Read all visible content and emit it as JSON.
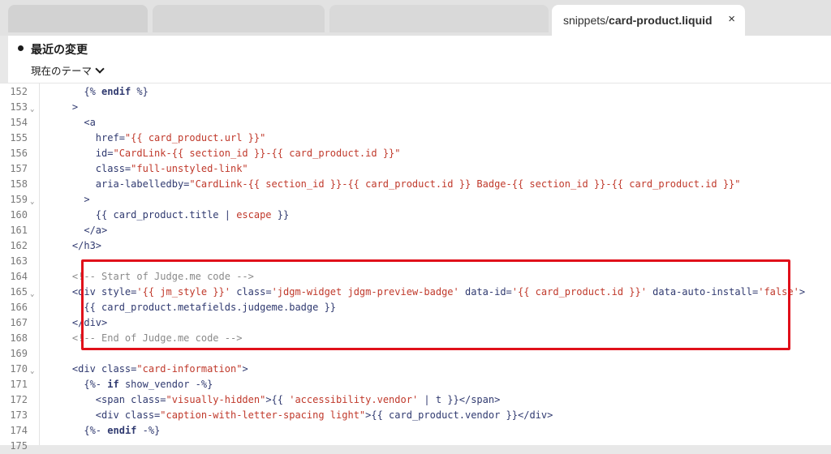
{
  "tabs": {
    "active": {
      "prefix": "snippets/",
      "name": "card-product.liquid"
    },
    "close_glyph": "×"
  },
  "header": {
    "title": "最近の変更",
    "theme_selector": "現在のテーマ"
  },
  "colors": {
    "highlight_border": "#e0101a",
    "string": "#c0392b",
    "comment": "#8a8a8a",
    "code": "#303a70"
  },
  "code": {
    "first_line_visible": 152,
    "lines": [
      {
        "n": "152",
        "fold": false,
        "indent": "      ",
        "segs": [
          [
            "{% ",
            "k"
          ],
          [
            "endif",
            "kw"
          ],
          [
            " %}",
            "k"
          ]
        ]
      },
      {
        "n": "153",
        "fold": true,
        "indent": "    ",
        "segs": [
          [
            ">",
            "k"
          ]
        ]
      },
      {
        "n": "154",
        "fold": false,
        "indent": "      ",
        "segs": [
          [
            "<a",
            "k"
          ]
        ]
      },
      {
        "n": "155",
        "fold": false,
        "indent": "        ",
        "segs": [
          [
            "href=",
            "k"
          ],
          [
            "\"{{ card_product.url }}\"",
            "s"
          ]
        ]
      },
      {
        "n": "156",
        "fold": false,
        "indent": "        ",
        "segs": [
          [
            "id=",
            "k"
          ],
          [
            "\"CardLink-{{ section_id }}-{{ card_product.id }}\"",
            "s"
          ]
        ]
      },
      {
        "n": "157",
        "fold": false,
        "indent": "        ",
        "segs": [
          [
            "class=",
            "k"
          ],
          [
            "\"full-unstyled-link\"",
            "s"
          ]
        ]
      },
      {
        "n": "158",
        "fold": false,
        "indent": "        ",
        "segs": [
          [
            "aria-labelledby=",
            "k"
          ],
          [
            "\"CardLink-{{ section_id }}-{{ card_product.id }} Badge-{{ section_id }}-{{ card_product.id }}\"",
            "s"
          ]
        ]
      },
      {
        "n": "159",
        "fold": true,
        "indent": "      ",
        "segs": [
          [
            ">",
            "k"
          ]
        ]
      },
      {
        "n": "160",
        "fold": false,
        "indent": "        ",
        "segs": [
          [
            "{{ card_product.title | ",
            "k"
          ],
          [
            "escape",
            "s"
          ],
          [
            " }}",
            "k"
          ]
        ]
      },
      {
        "n": "161",
        "fold": false,
        "indent": "      ",
        "segs": [
          [
            "</a>",
            "k"
          ]
        ]
      },
      {
        "n": "162",
        "fold": false,
        "indent": "    ",
        "segs": [
          [
            "</h3>",
            "k"
          ]
        ]
      },
      {
        "n": "163",
        "fold": false,
        "indent": "",
        "segs": []
      },
      {
        "n": "164",
        "fold": false,
        "indent": "    ",
        "segs": [
          [
            "<!-- Start of Judge.me code -->",
            "c"
          ]
        ]
      },
      {
        "n": "165",
        "fold": true,
        "indent": "    ",
        "segs": [
          [
            "<div style=",
            "k"
          ],
          [
            "'{{ jm_style }}'",
            "s"
          ],
          [
            " class=",
            "k"
          ],
          [
            "'jdgm-widget jdgm-preview-badge'",
            "s"
          ],
          [
            " data-id=",
            "k"
          ],
          [
            "'{{ card_product.id }}'",
            "s"
          ],
          [
            " data-auto-install=",
            "k"
          ],
          [
            "'false'",
            "s"
          ],
          [
            ">",
            "k"
          ]
        ]
      },
      {
        "n": "166",
        "fold": false,
        "indent": "      ",
        "segs": [
          [
            "{{ card_product.metafields.judgeme.badge }}",
            "k"
          ]
        ]
      },
      {
        "n": "167",
        "fold": false,
        "indent": "    ",
        "segs": [
          [
            "</div>",
            "k"
          ]
        ]
      },
      {
        "n": "168",
        "fold": false,
        "indent": "    ",
        "segs": [
          [
            "<!-- End of Judge.me code -->",
            "c"
          ]
        ]
      },
      {
        "n": "169",
        "fold": false,
        "indent": "",
        "segs": []
      },
      {
        "n": "170",
        "fold": true,
        "indent": "    ",
        "segs": [
          [
            "<div class=",
            "k"
          ],
          [
            "\"card-information\"",
            "s"
          ],
          [
            ">",
            "k"
          ]
        ]
      },
      {
        "n": "171",
        "fold": false,
        "indent": "      ",
        "segs": [
          [
            "{%- ",
            "k"
          ],
          [
            "if",
            "kw"
          ],
          [
            " show_vendor -%}",
            "k"
          ]
        ]
      },
      {
        "n": "172",
        "fold": false,
        "indent": "        ",
        "segs": [
          [
            "<span class=",
            "k"
          ],
          [
            "\"visually-hidden\"",
            "s"
          ],
          [
            ">{{ ",
            "k"
          ],
          [
            "'accessibility.vendor'",
            "s"
          ],
          [
            " | t }}</span>",
            "k"
          ]
        ]
      },
      {
        "n": "173",
        "fold": false,
        "indent": "        ",
        "segs": [
          [
            "<div class=",
            "k"
          ],
          [
            "\"caption-with-letter-spacing light\"",
            "s"
          ],
          [
            ">{{ card_product.vendor }}</div>",
            "k"
          ]
        ]
      },
      {
        "n": "174",
        "fold": false,
        "indent": "      ",
        "segs": [
          [
            "{%- ",
            "k"
          ],
          [
            "endif",
            "kw"
          ],
          [
            " -%}",
            "k"
          ]
        ]
      },
      {
        "n": "175",
        "fold": false,
        "indent": "",
        "segs": []
      }
    ]
  }
}
